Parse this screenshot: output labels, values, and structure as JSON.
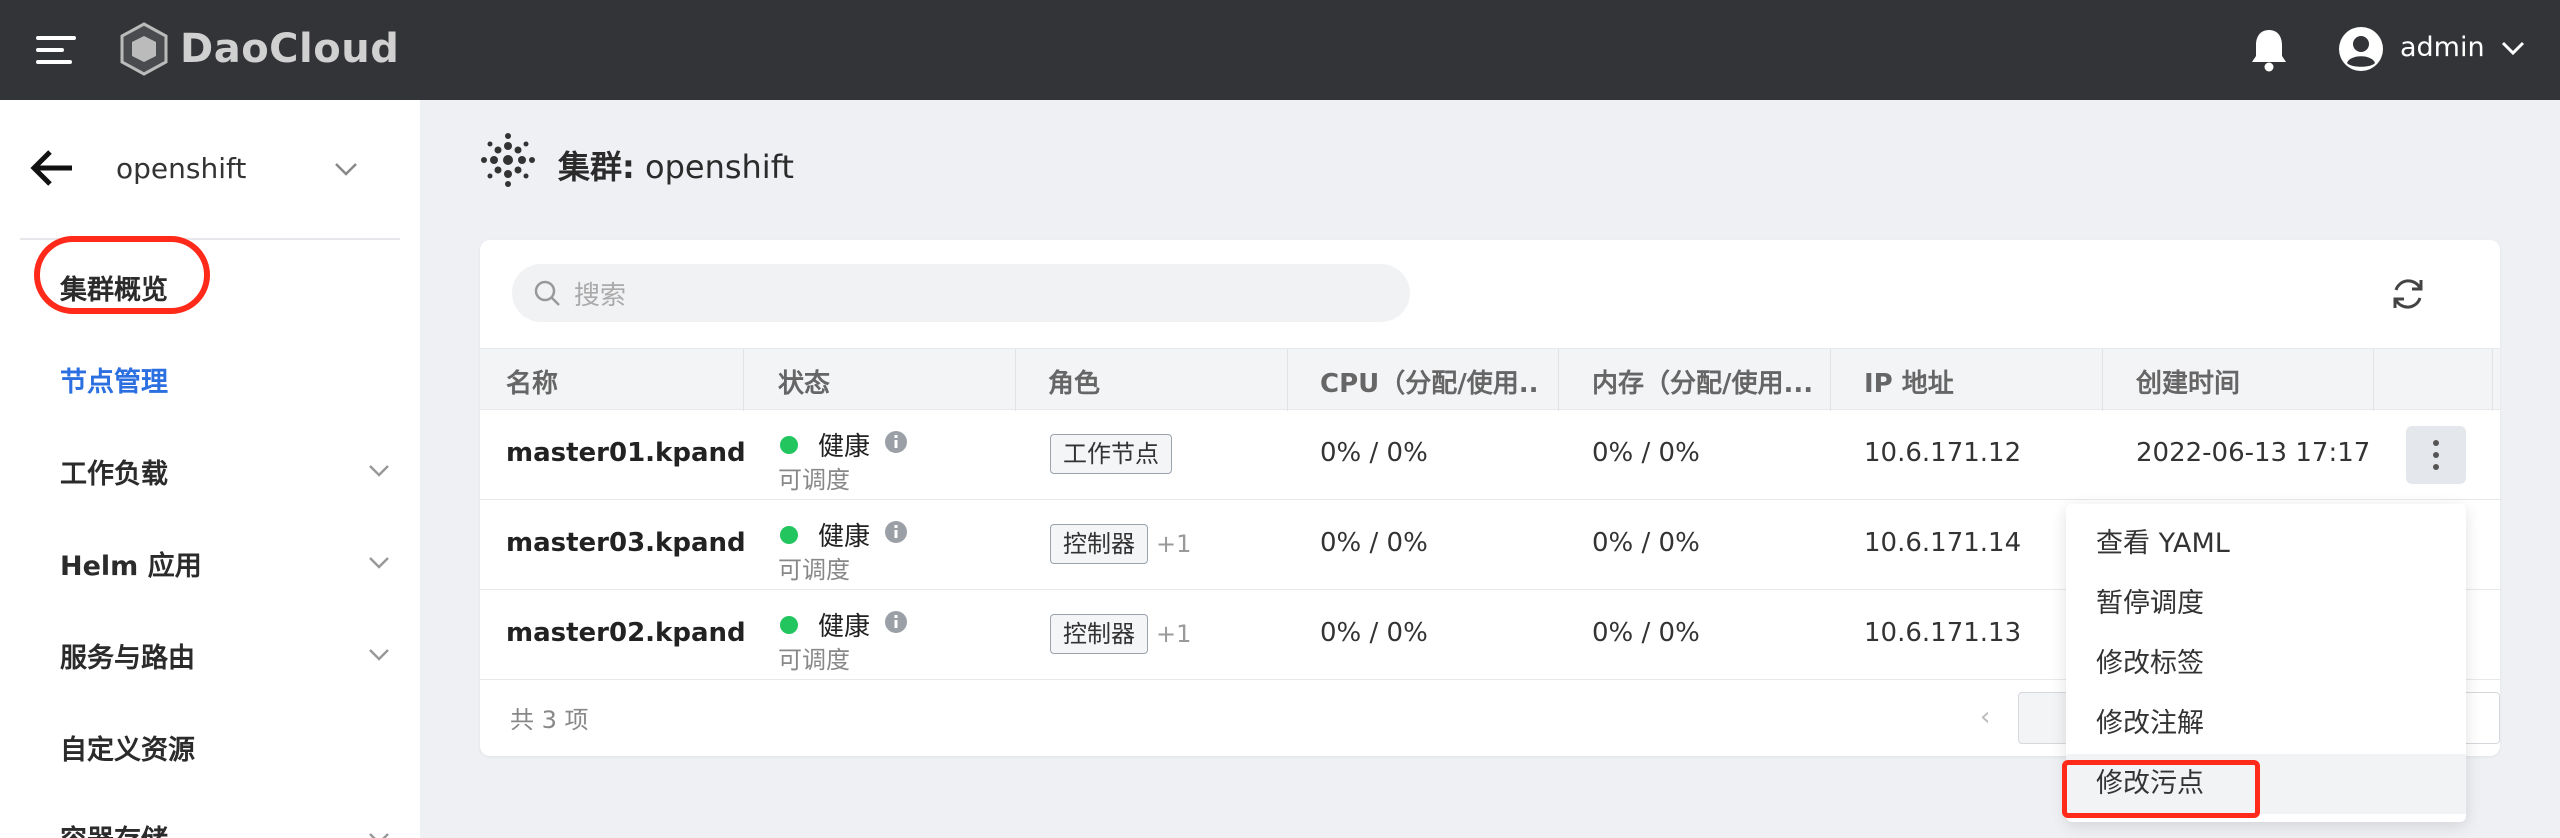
{
  "header": {
    "logo_text": "DaoCloud",
    "user": "admin"
  },
  "sidebar": {
    "cluster": "openshift",
    "items": [
      {
        "label": "集群概览",
        "expandable": false,
        "active": false
      },
      {
        "label": "节点管理",
        "expandable": false,
        "active": true
      },
      {
        "label": "工作负载",
        "expandable": true,
        "active": false
      },
      {
        "label": "Helm 应用",
        "expandable": true,
        "active": false
      },
      {
        "label": "服务与路由",
        "expandable": true,
        "active": false
      },
      {
        "label": "自定义资源",
        "expandable": false,
        "active": false
      },
      {
        "label": "容器存储",
        "expandable": true,
        "active": false
      }
    ]
  },
  "page": {
    "title_prefix": "集群:",
    "title_value": "openshift"
  },
  "search": {
    "placeholder": "搜索"
  },
  "table": {
    "columns": [
      "名称",
      "状态",
      "角色",
      "CPU（分配/使用...",
      "内存（分配/使用...",
      "IP 地址",
      "创建时间"
    ],
    "rows": [
      {
        "name": "master01.kpand...",
        "status": "健康",
        "sched": "可调度",
        "role": "工作节点",
        "role_extra": "",
        "cpu": "0% / 0%",
        "mem": "0% / 0%",
        "ip": "10.6.171.12",
        "created": "2022-06-13 17:17"
      },
      {
        "name": "master03.kpand...",
        "status": "健康",
        "sched": "可调度",
        "role": "控制器",
        "role_extra": "+1",
        "cpu": "0% / 0%",
        "mem": "0% / 0%",
        "ip": "10.6.171.14",
        "created": ""
      },
      {
        "name": "master02.kpand...",
        "status": "健康",
        "sched": "可调度",
        "role": "控制器",
        "role_extra": "+1",
        "cpu": "0% / 0%",
        "mem": "0% / 0%",
        "ip": "10.6.171.13",
        "created": ""
      }
    ],
    "total": "共 3 项"
  },
  "menu": {
    "items": [
      "查看 YAML",
      "暂停调度",
      "修改标签",
      "修改注解",
      "修改污点"
    ]
  },
  "colors": {
    "topbar": "#333437",
    "accent": "#2b6fe0",
    "health": "#22c55e",
    "highlight_ring": "#ff2a1a"
  }
}
